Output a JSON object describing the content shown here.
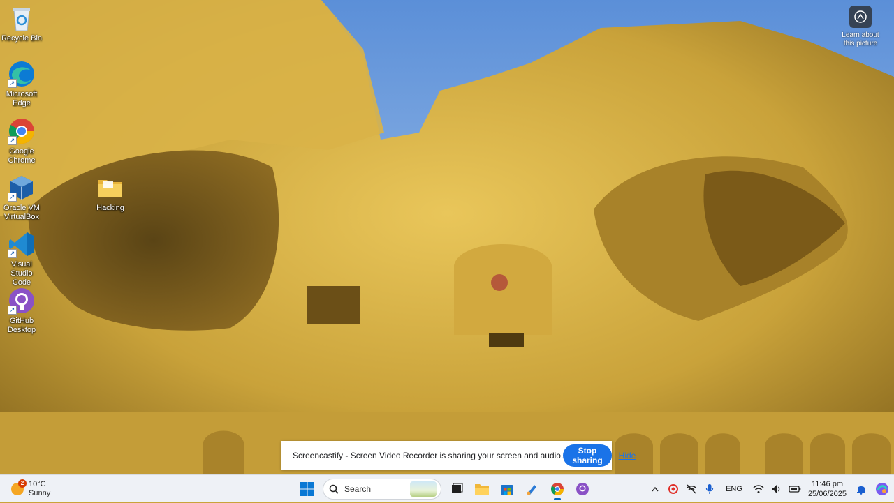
{
  "desktop": {
    "icons": [
      {
        "label": "Recycle Bin",
        "icon": "recycle-bin-icon"
      },
      {
        "label": "Microsoft\nEdge",
        "icon": "edge-icon"
      },
      {
        "label": "Google\nChrome",
        "icon": "chrome-icon"
      },
      {
        "label": "Oracle VM\nVirtualBox",
        "icon": "virtualbox-icon"
      },
      {
        "label": "Visual Studio\nCode",
        "icon": "vscode-icon"
      },
      {
        "label": "GitHub\nDesktop",
        "icon": "github-desktop-icon"
      },
      {
        "label": "Hacking",
        "icon": "folder-icon"
      }
    ],
    "learn_about": "Learn about\nthis picture"
  },
  "share_bar": {
    "message": "Screencastify - Screen Video Recorder is sharing your screen and audio.",
    "stop_label": "Stop sharing",
    "hide_label": "Hide"
  },
  "taskbar": {
    "weather": {
      "temp": "10°C",
      "condition": "Sunny",
      "badge": "2"
    },
    "search_placeholder": "Search",
    "apps": [
      "start-icon",
      "search",
      "task-view-icon",
      "file-explorer-icon",
      "microsoft-store-icon",
      "paint-icon",
      "chrome-icon",
      "github-desktop-icon"
    ],
    "tray": {
      "language": "ENG",
      "time": "11:46 pm",
      "date": "25/06/2025"
    }
  },
  "colors": {
    "accent": "#1a73e8",
    "taskbar_bg": "#eef1f6"
  }
}
